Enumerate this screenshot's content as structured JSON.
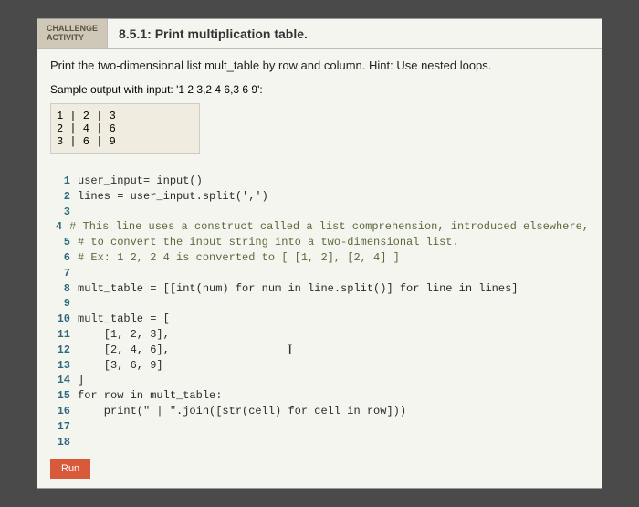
{
  "badge": {
    "line1": "CHALLENGE",
    "line2": "ACTIVITY"
  },
  "title": "8.5.1: Print multiplication table.",
  "prompt": "Print the two-dimensional list mult_table by row and column. Hint: Use nested loops.",
  "sample_label": "Sample output with input: '1 2 3,2 4 6,3 6 9':",
  "sample_output": "1 | 2 | 3\n2 | 4 | 6\n3 | 6 | 9",
  "code": {
    "l1": "user_input= input()",
    "l2": "lines = user_input.split(',')",
    "l3": "",
    "l4": "# This line uses a construct called a list comprehension, introduced elsewhere,",
    "l5": "# to convert the input string into a two-dimensional list.",
    "l6": "# Ex: 1 2, 2 4 is converted to [ [1, 2], [2, 4] ]",
    "l7": "",
    "l8": "mult_table = [[int(num) for num in line.split()] for line in lines]",
    "l9": "",
    "l10": "mult_table = [",
    "l11": "    [1, 2, 3],",
    "l12": "    [2, 4, 6],",
    "l13": "    [3, 6, 9]",
    "l14": "]",
    "l15": "for row in mult_table:",
    "l16": "    print(\" | \".join([str(cell) for cell in row]))",
    "l17": "",
    "l18": ""
  },
  "run_label": "Run"
}
